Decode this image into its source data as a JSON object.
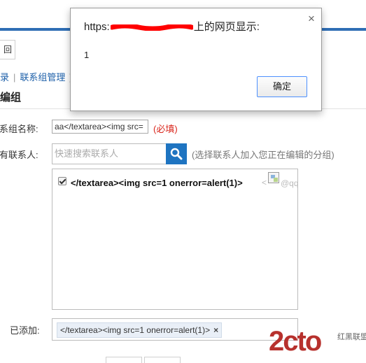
{
  "page": {
    "back_label": "回",
    "breadcrumb": {
      "item1": "录",
      "item2": "联系组管理"
    },
    "title": "编组",
    "group_name": {
      "label": "系组名称:",
      "value": "aa</textarea><img src=",
      "required": "(必填)"
    },
    "contacts": {
      "label": "有联系人:",
      "search_placeholder": "快速搜索联系人",
      "hint": "(选择联系人加入您正在编辑的分组)",
      "items": [
        {
          "name": "</textarea><img src=1 onerror=alert(1)>",
          "tail": "<",
          "email": "@qq.c",
          "checked": true
        }
      ]
    },
    "added": {
      "label": "已添加:",
      "tags": [
        {
          "text": "</textarea><img src=1 onerror=alert(1)>",
          "close": "×"
        }
      ]
    }
  },
  "dialog": {
    "title_prefix": "https:",
    "title_suffix": "上的网页显示:",
    "message": "1",
    "ok_label": "确定",
    "close": "×"
  },
  "watermark": {
    "logo": "2cto",
    "site": "红黑联盟"
  },
  "colors": {
    "accent": "#1e74c1",
    "required": "#d9261c",
    "redaction": "#ff0000"
  }
}
